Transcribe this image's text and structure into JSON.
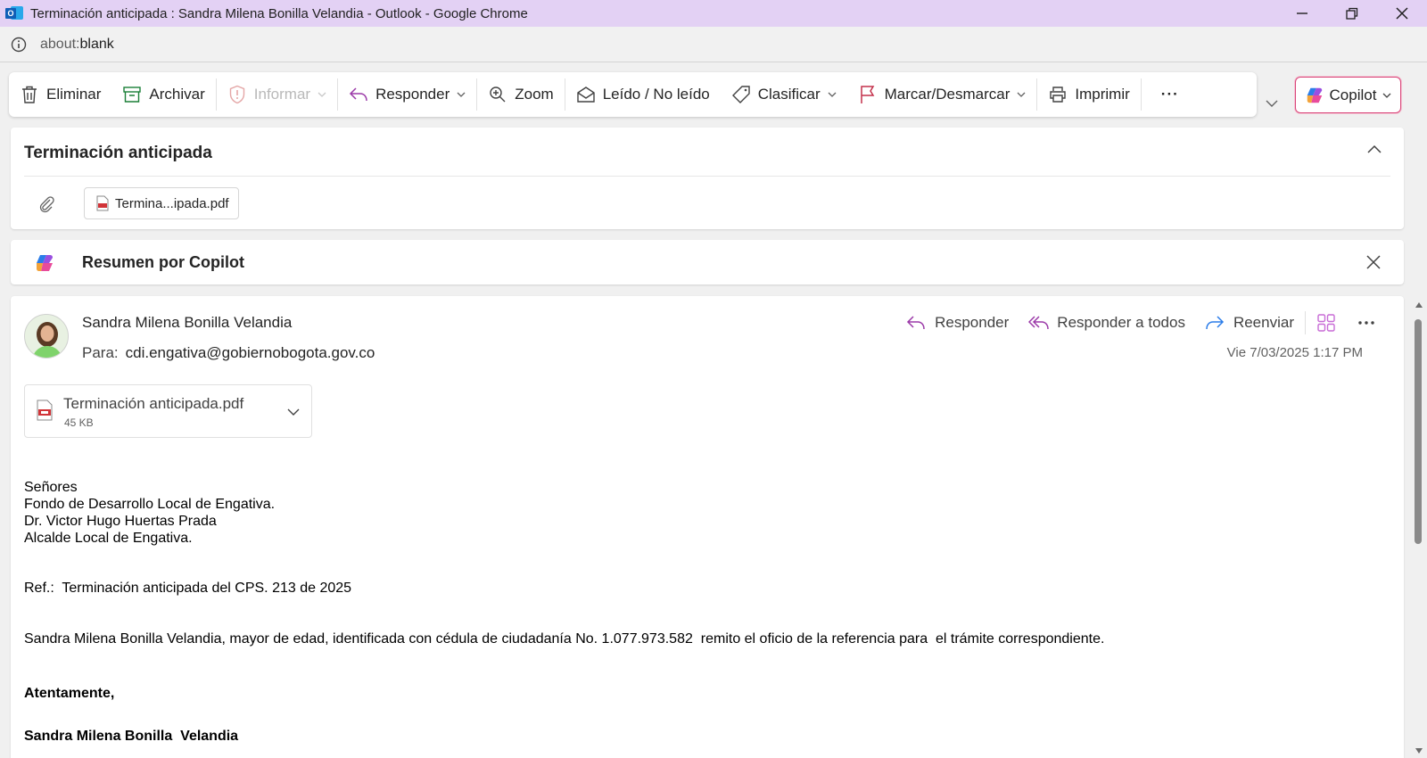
{
  "window": {
    "title": "Terminación anticipada : Sandra Milena Bonilla Velandia - Outlook - Google Chrome",
    "url_scheme": "about:",
    "url_rest": "blank"
  },
  "ribbon": {
    "eliminar": "Eliminar",
    "archivar": "Archivar",
    "informar": "Informar",
    "responder": "Responder",
    "zoom": "Zoom",
    "leido": "Leído / No leído",
    "clasificar": "Clasificar",
    "marcar": "Marcar/Desmarcar",
    "imprimir": "Imprimir",
    "more": "···",
    "copilot": "Copilot"
  },
  "subject_card": {
    "subject": "Terminación anticipada",
    "attachment_chip": "Termina...ipada.pdf"
  },
  "summary": {
    "title": "Resumen por Copilot"
  },
  "message": {
    "sender": "Sandra Milena Bonilla Velandia",
    "to_label": "Para:",
    "to_address": "cdi.engativa@gobiernobogota.gov.co",
    "date": "Vie 7/03/2025 1:17 PM",
    "actions": {
      "reply": "Responder",
      "reply_all": "Responder a todos",
      "forward": "Reenviar"
    },
    "attachment": {
      "name": "Terminación anticipada.pdf",
      "size": "45 KB"
    },
    "body": {
      "line1": "Señores",
      "line2": "Fondo de Desarrollo Local de Engativa.",
      "line3": "Dr. Victor Hugo Huertas Prada",
      "line4": "Alcalde Local de Engativa.",
      "ref": "Ref.:  Terminación anticipada del CPS. 213 de 2025",
      "para": "Sandra Milena Bonilla Velandia, mayor de edad, identificada con cédula de ciudadanía No. 1.077.973.582  remito el oficio de la referencia para  el trámite correspondiente.",
      "closing": "Atentamente,",
      "signature": "Sandra Milena Bonilla  Velandia"
    }
  },
  "colors": {
    "titlebar": "#e3d1f4",
    "accent_purple": "#9b3aa8",
    "copilot_border": "#d9477a",
    "pdf_red": "#d13438"
  }
}
